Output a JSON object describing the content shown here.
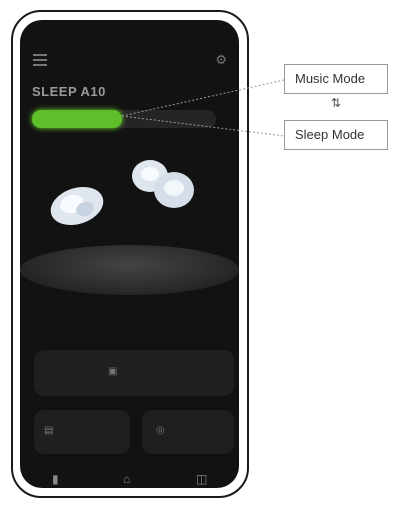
{
  "screen": {
    "status_text": "",
    "device_name": "SLEEP A10",
    "mode_toggle": {
      "active_label": "",
      "inactive_label": ""
    },
    "battery": {
      "left": "",
      "right": ""
    },
    "cards": {
      "main_label": "",
      "left_label": "",
      "right_label": ""
    },
    "accent_color": "#5fbf2a"
  },
  "annotations": {
    "music_mode": "Music Mode",
    "sleep_mode": "Sleep Mode",
    "swap_symbol": "⇅"
  },
  "icons": [
    "menu-icon",
    "settings-icon",
    "earbud-left-image",
    "earbud-right-image",
    "home-icon",
    "library-icon",
    "stats-icon"
  ]
}
